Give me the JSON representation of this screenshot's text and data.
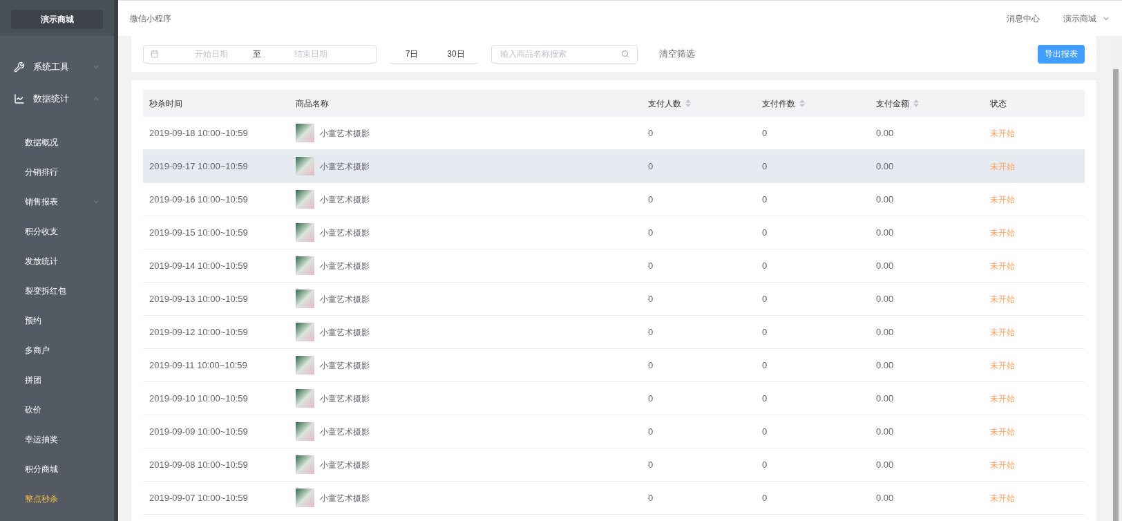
{
  "sidebar": {
    "brand": "演示商城",
    "groups": [
      {
        "label": "系统工具",
        "expanded": false
      },
      {
        "label": "数据统计",
        "expanded": true,
        "children": [
          {
            "label": "数据概况",
            "selected": false,
            "has_submenu": false
          },
          {
            "label": "分销排行",
            "selected": false,
            "has_submenu": false
          },
          {
            "label": "销售报表",
            "selected": false,
            "has_submenu": true
          },
          {
            "label": "积分收支",
            "selected": false,
            "has_submenu": false
          },
          {
            "label": "发放统计",
            "selected": false,
            "has_submenu": false
          },
          {
            "label": "裂变拆红包",
            "selected": false,
            "has_submenu": false
          },
          {
            "label": "预约",
            "selected": false,
            "has_submenu": false
          },
          {
            "label": "多商户",
            "selected": false,
            "has_submenu": false
          },
          {
            "label": "拼团",
            "selected": false,
            "has_submenu": false
          },
          {
            "label": "砍价",
            "selected": false,
            "has_submenu": false
          },
          {
            "label": "幸运抽奖",
            "selected": false,
            "has_submenu": false
          },
          {
            "label": "积分商城",
            "selected": false,
            "has_submenu": false
          },
          {
            "label": "整点秒杀",
            "selected": true,
            "has_submenu": false
          }
        ]
      }
    ]
  },
  "header": {
    "title": "微信小程序",
    "links": [
      "消息中心"
    ],
    "account": "演示商城"
  },
  "filters": {
    "start_placeholder": "开始日期",
    "separator": "至",
    "end_placeholder": "结束日期",
    "quick_ranges": [
      "7日",
      "30日"
    ],
    "search_placeholder": "输入商品名称搜索",
    "clear": "清空筛选",
    "export": "导出报表"
  },
  "table": {
    "columns": [
      {
        "label": "秒杀时间",
        "sortable": false
      },
      {
        "label": "商品名称",
        "sortable": false
      },
      {
        "label": "支付人数",
        "sortable": true
      },
      {
        "label": "支付件数",
        "sortable": true
      },
      {
        "label": "支付金额",
        "sortable": true
      },
      {
        "label": "状态",
        "sortable": false
      }
    ],
    "rows": [
      {
        "time": "2019-09-18 10:00~10:59",
        "product": "小童艺术摄影",
        "buyers": "0",
        "items": "0",
        "amount": "0.00",
        "status": "未开始",
        "highlighted": false
      },
      {
        "time": "2019-09-17 10:00~10:59",
        "product": "小童艺术摄影",
        "buyers": "0",
        "items": "0",
        "amount": "0.00",
        "status": "未开始",
        "highlighted": true
      },
      {
        "time": "2019-09-16 10:00~10:59",
        "product": "小童艺术摄影",
        "buyers": "0",
        "items": "0",
        "amount": "0.00",
        "status": "未开始",
        "highlighted": false
      },
      {
        "time": "2019-09-15 10:00~10:59",
        "product": "小童艺术摄影",
        "buyers": "0",
        "items": "0",
        "amount": "0.00",
        "status": "未开始",
        "highlighted": false
      },
      {
        "time": "2019-09-14 10:00~10:59",
        "product": "小童艺术摄影",
        "buyers": "0",
        "items": "0",
        "amount": "0.00",
        "status": "未开始",
        "highlighted": false
      },
      {
        "time": "2019-09-13 10:00~10:59",
        "product": "小童艺术摄影",
        "buyers": "0",
        "items": "0",
        "amount": "0.00",
        "status": "未开始",
        "highlighted": false
      },
      {
        "time": "2019-09-12 10:00~10:59",
        "product": "小童艺术摄影",
        "buyers": "0",
        "items": "0",
        "amount": "0.00",
        "status": "未开始",
        "highlighted": false
      },
      {
        "time": "2019-09-11 10:00~10:59",
        "product": "小童艺术摄影",
        "buyers": "0",
        "items": "0",
        "amount": "0.00",
        "status": "未开始",
        "highlighted": false
      },
      {
        "time": "2019-09-10 10:00~10:59",
        "product": "小童艺术摄影",
        "buyers": "0",
        "items": "0",
        "amount": "0.00",
        "status": "未开始",
        "highlighted": false
      },
      {
        "time": "2019-09-09 10:00~10:59",
        "product": "小童艺术摄影",
        "buyers": "0",
        "items": "0",
        "amount": "0.00",
        "status": "未开始",
        "highlighted": false
      },
      {
        "time": "2019-09-08 10:00~10:59",
        "product": "小童艺术摄影",
        "buyers": "0",
        "items": "0",
        "amount": "0.00",
        "status": "未开始",
        "highlighted": false
      },
      {
        "time": "2019-09-07 10:00~10:59",
        "product": "小童艺术摄影",
        "buyers": "0",
        "items": "0",
        "amount": "0.00",
        "status": "未开始",
        "highlighted": false
      }
    ]
  }
}
